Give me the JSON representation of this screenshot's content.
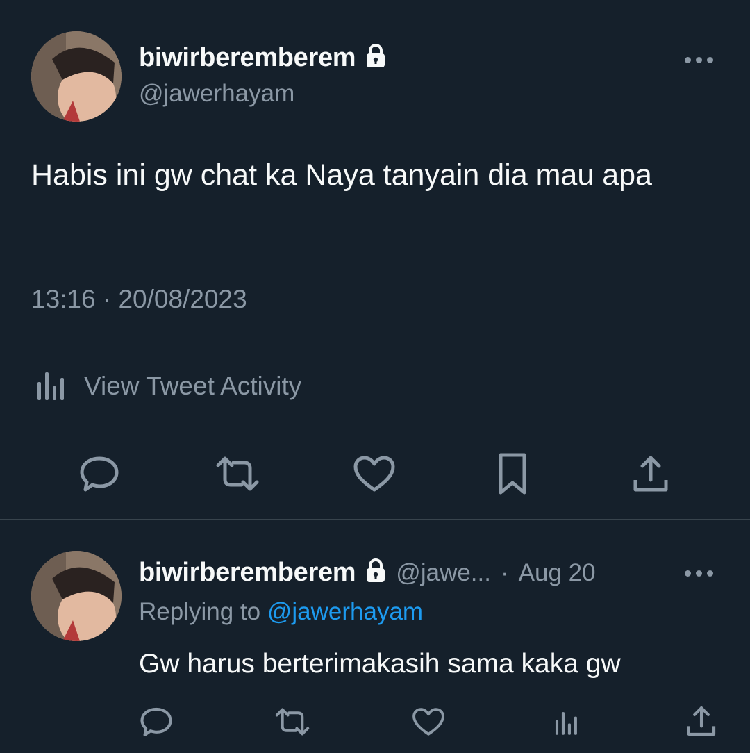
{
  "main_tweet": {
    "display_name": "biwirberemberem",
    "handle": "@jawerhayam",
    "text": "Habis ini gw chat ka Naya tanyain dia mau apa",
    "timestamp": "13:16 · 20/08/2023",
    "activity_label": "View Tweet Activity",
    "icons": {
      "lock": "lock-icon",
      "more": "more-icon",
      "analytics": "analytics-icon",
      "reply": "reply-icon",
      "retweet": "retweet-icon",
      "like": "like-icon",
      "bookmark": "bookmark-icon",
      "share": "share-icon"
    }
  },
  "reply_tweet": {
    "display_name": "biwirberemberem",
    "handle": "@jawe...",
    "separator": "·",
    "date": "Aug 20",
    "replying_to_label": "Replying to",
    "replying_to_handle": "@jawerhayam",
    "text": "Gw harus berterimakasih sama kaka gw",
    "icons": {
      "reply": "reply-icon",
      "retweet": "retweet-icon",
      "like": "like-icon",
      "analytics": "analytics-icon",
      "share": "share-icon"
    }
  },
  "colors": {
    "background": "#15202b",
    "text": "#f7f9f9",
    "muted": "#8b98a5",
    "divider": "#38444d",
    "link": "#1d9bf0"
  }
}
